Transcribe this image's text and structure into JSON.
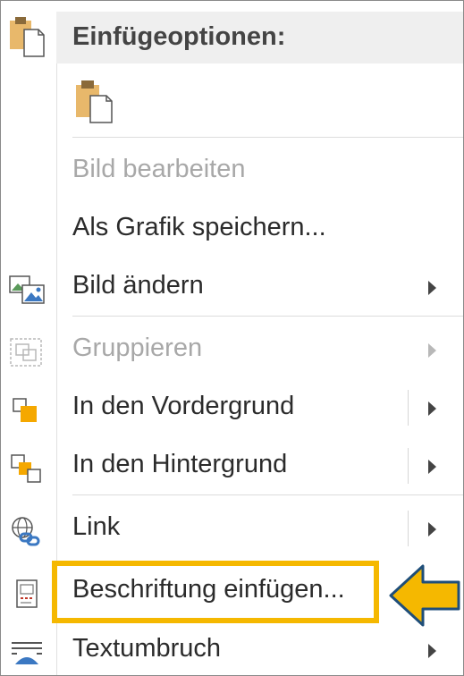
{
  "header": {
    "title": "Einfügeoptionen:"
  },
  "icons": {
    "paste": "clipboard-paste-icon",
    "change_picture": "change-picture-icon",
    "group": "group-icon",
    "bring_forward": "bring-forward-icon",
    "send_backward": "send-backward-icon",
    "link": "link-icon",
    "caption": "insert-caption-icon",
    "wrap": "text-wrap-icon"
  },
  "items": [
    {
      "key": "edit_picture",
      "label": "Bild bearbeiten",
      "enabled": false
    },
    {
      "key": "save_as_graphic",
      "label": "Als Grafik speichern...",
      "enabled": true
    },
    {
      "key": "change_picture",
      "label": "Bild ändern",
      "enabled": true
    },
    {
      "key": "group",
      "label": "Gruppieren",
      "enabled": false
    },
    {
      "key": "bring_forward",
      "label": "In den Vordergrund",
      "enabled": true
    },
    {
      "key": "send_backward",
      "label": "In den Hintergrund",
      "enabled": true
    },
    {
      "key": "link",
      "label": "Link",
      "enabled": true
    },
    {
      "key": "insert_caption",
      "label": "Beschriftung einfügen...",
      "enabled": true
    },
    {
      "key": "text_wrap",
      "label": "Textumbruch",
      "enabled": true
    }
  ],
  "colors": {
    "highlight": "#f5b800",
    "pointer_fill": "#f5b800",
    "pointer_stroke": "#1f4e79",
    "clipboard": "#e8b86b"
  }
}
